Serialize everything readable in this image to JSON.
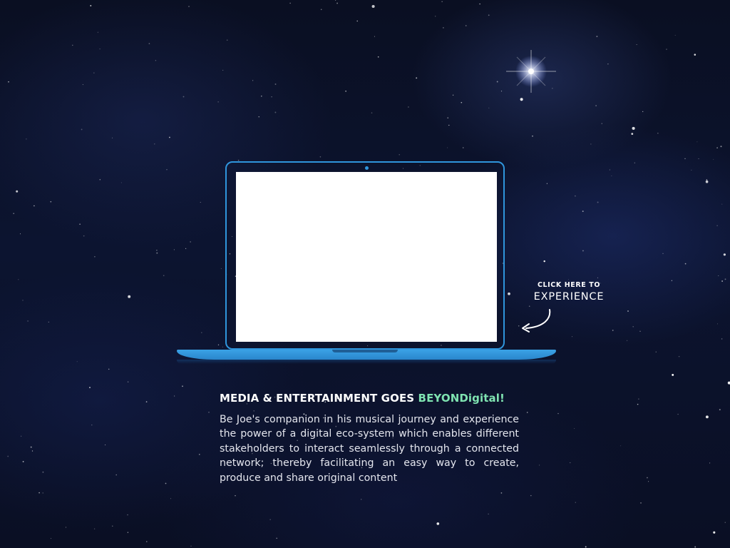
{
  "cta": {
    "line1": "CLICK HERE TO",
    "line2": "EXPERIENCE"
  },
  "content": {
    "headline_prefix": "MEDIA & ENTERTAINMENT GOES ",
    "headline_brand": "BEYONDigital!",
    "description": "Be Joe's companion in his musical journey and experience the power of a digital eco-system which enables different stakeholders to interact seamlessly through a connected network; thereby facilitating an easy way to create, produce and share original content"
  },
  "colors": {
    "laptop_outline": "#2f95dc",
    "brand_accent": "#7fe3b1",
    "background": "#0c1430"
  }
}
